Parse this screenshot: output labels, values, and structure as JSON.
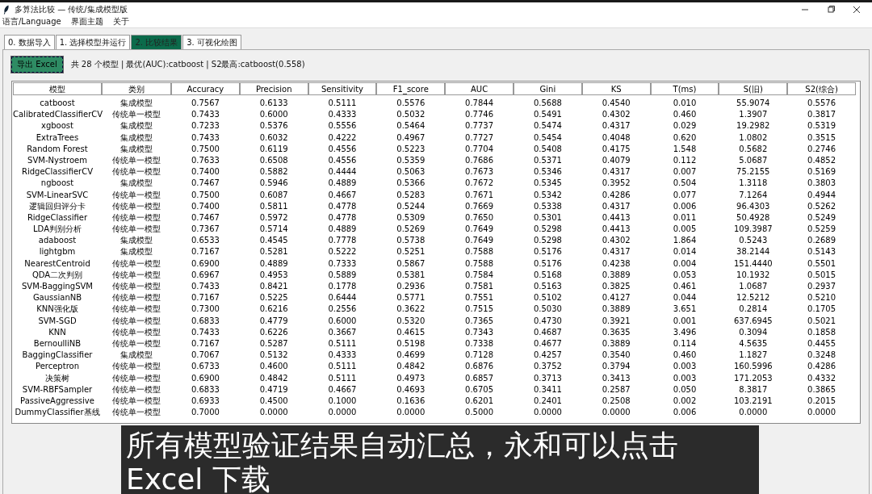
{
  "window": {
    "title": "多算法比较 — 传统/集成模型版"
  },
  "menu": [
    "语言/Language",
    "界面主题",
    "关于"
  ],
  "tabs": [
    {
      "label": "0. 数据导入",
      "selected": false
    },
    {
      "label": "1. 选择模型并运行",
      "selected": false
    },
    {
      "label": "2. 比较结果",
      "selected": true
    },
    {
      "label": "3. 可视化绘图",
      "selected": false
    }
  ],
  "export_button": "导出 Excel",
  "summary": "共 28 个模型 | 最优(AUC):catboost | S2最高:catboost(0.558)",
  "table": {
    "columns": [
      "模型",
      "类别",
      "Accuracy",
      "Precision",
      "Sensitivity",
      "F1_score",
      "AUC",
      "Gini",
      "KS",
      "T(ms)",
      "S(旧)",
      "S2(综合)"
    ],
    "rows": [
      [
        "catboost",
        "集成模型",
        "0.7567",
        "0.6133",
        "0.5111",
        "0.5576",
        "0.7844",
        "0.5688",
        "0.4540",
        "0.010",
        "55.9074",
        "0.5576"
      ],
      [
        "CalibratedClassifierCV",
        "传统单一模型",
        "0.7433",
        "0.6000",
        "0.4333",
        "0.5032",
        "0.7746",
        "0.5491",
        "0.4302",
        "0.460",
        "1.3907",
        "0.3817"
      ],
      [
        "xgboost",
        "集成模型",
        "0.7233",
        "0.5376",
        "0.5556",
        "0.5464",
        "0.7737",
        "0.5474",
        "0.4317",
        "0.029",
        "19.2982",
        "0.5319"
      ],
      [
        "ExtraTrees",
        "集成模型",
        "0.7433",
        "0.6032",
        "0.4222",
        "0.4967",
        "0.7727",
        "0.5454",
        "0.4048",
        "0.620",
        "1.0802",
        "0.3515"
      ],
      [
        "Random Forest",
        "集成模型",
        "0.7500",
        "0.6119",
        "0.4556",
        "0.5223",
        "0.7704",
        "0.5408",
        "0.4175",
        "1.548",
        "0.5682",
        "0.2746"
      ],
      [
        "SVM-Nystroem",
        "传统单一模型",
        "0.7633",
        "0.6508",
        "0.4556",
        "0.5359",
        "0.7686",
        "0.5371",
        "0.4079",
        "0.112",
        "5.0687",
        "0.4852"
      ],
      [
        "RidgeClassifierCV",
        "传统单一模型",
        "0.7400",
        "0.5882",
        "0.4444",
        "0.5063",
        "0.7673",
        "0.5346",
        "0.4317",
        "0.007",
        "75.2155",
        "0.5169"
      ],
      [
        "ngboost",
        "集成模型",
        "0.7467",
        "0.5946",
        "0.4889",
        "0.5366",
        "0.7672",
        "0.5345",
        "0.3952",
        "0.504",
        "1.3118",
        "0.3803"
      ],
      [
        "SVM-LinearSVC",
        "传统单一模型",
        "0.7500",
        "0.6087",
        "0.4667",
        "0.5283",
        "0.7671",
        "0.5342",
        "0.4286",
        "0.077",
        "7.1264",
        "0.4944"
      ],
      [
        "逻辑回归评分卡",
        "传统单一模型",
        "0.7400",
        "0.5811",
        "0.4778",
        "0.5244",
        "0.7669",
        "0.5338",
        "0.4317",
        "0.006",
        "96.4303",
        "0.5262"
      ],
      [
        "RidgeClassifier",
        "传统单一模型",
        "0.7467",
        "0.5972",
        "0.4778",
        "0.5309",
        "0.7650",
        "0.5301",
        "0.4413",
        "0.011",
        "50.4928",
        "0.5249"
      ],
      [
        "LDA判别分析",
        "传统单一模型",
        "0.7367",
        "0.5714",
        "0.4889",
        "0.5269",
        "0.7649",
        "0.5298",
        "0.4413",
        "0.005",
        "109.3987",
        "0.5259"
      ],
      [
        "adaboost",
        "集成模型",
        "0.6533",
        "0.4545",
        "0.7778",
        "0.5738",
        "0.7649",
        "0.5298",
        "0.4302",
        "1.864",
        "0.5243",
        "0.2689"
      ],
      [
        "lightgbm",
        "集成模型",
        "0.7167",
        "0.5281",
        "0.5222",
        "0.5251",
        "0.7588",
        "0.5176",
        "0.4317",
        "0.014",
        "38.2144",
        "0.5143"
      ],
      [
        "NearestCentroid",
        "传统单一模型",
        "0.6900",
        "0.4889",
        "0.7333",
        "0.5867",
        "0.7588",
        "0.5176",
        "0.4238",
        "0.004",
        "151.4440",
        "0.5501"
      ],
      [
        "QDA二次判别",
        "传统单一模型",
        "0.6967",
        "0.4953",
        "0.5889",
        "0.5381",
        "0.7584",
        "0.5168",
        "0.3889",
        "0.053",
        "10.1932",
        "0.5015"
      ],
      [
        "SVM-BaggingSVM",
        "传统单一模型",
        "0.7433",
        "0.8421",
        "0.1778",
        "0.2936",
        "0.7581",
        "0.5163",
        "0.3825",
        "0.461",
        "1.0687",
        "0.2937"
      ],
      [
        "GaussianNB",
        "传统单一模型",
        "0.7167",
        "0.5225",
        "0.6444",
        "0.5771",
        "0.7551",
        "0.5102",
        "0.4127",
        "0.044",
        "12.5212",
        "0.5210"
      ],
      [
        "KNN强化版",
        "传统单一模型",
        "0.7300",
        "0.6216",
        "0.2556",
        "0.3622",
        "0.7515",
        "0.5030",
        "0.3889",
        "3.651",
        "0.2814",
        "0.1705"
      ],
      [
        "SVM-SGD",
        "传统单一模型",
        "0.6833",
        "0.4779",
        "0.6000",
        "0.5320",
        "0.7365",
        "0.4730",
        "0.3921",
        "0.001",
        "637.6945",
        "0.5021"
      ],
      [
        "KNN",
        "传统单一模型",
        "0.7433",
        "0.6226",
        "0.3667",
        "0.4615",
        "0.7343",
        "0.4687",
        "0.3635",
        "3.496",
        "0.3094",
        "0.1858"
      ],
      [
        "BernoulliNB",
        "传统单一模型",
        "0.7167",
        "0.5287",
        "0.5111",
        "0.5198",
        "0.7338",
        "0.4677",
        "0.3889",
        "0.114",
        "4.5635",
        "0.4455"
      ],
      [
        "BaggingClassifier",
        "集成模型",
        "0.7067",
        "0.5132",
        "0.4333",
        "0.4699",
        "0.7128",
        "0.4257",
        "0.3540",
        "0.460",
        "1.1827",
        "0.3248"
      ],
      [
        "Perceptron",
        "传统单一模型",
        "0.6733",
        "0.4600",
        "0.5111",
        "0.4842",
        "0.6876",
        "0.3752",
        "0.3794",
        "0.003",
        "160.5996",
        "0.4286"
      ],
      [
        "决策树",
        "传统单一模型",
        "0.6900",
        "0.4842",
        "0.5111",
        "0.4973",
        "0.6857",
        "0.3713",
        "0.3413",
        "0.003",
        "171.2053",
        "0.4332"
      ],
      [
        "SVM-RBFSampler",
        "传统单一模型",
        "0.6833",
        "0.4719",
        "0.4667",
        "0.4693",
        "0.6705",
        "0.3411",
        "0.2587",
        "0.050",
        "8.3817",
        "0.3865"
      ],
      [
        "PassiveAggressive",
        "传统单一模型",
        "0.6933",
        "0.4500",
        "0.1000",
        "0.1636",
        "0.6201",
        "0.2401",
        "0.2508",
        "0.002",
        "103.2191",
        "0.2015"
      ],
      [
        "DummyClassifier基线",
        "传统单一模型",
        "0.7000",
        "0.0000",
        "0.0000",
        "0.0000",
        "0.5000",
        "0.0000",
        "0.0000",
        "0.006",
        "0.0000",
        "0.0000"
      ]
    ]
  },
  "caption": "所有模型验证结果自动汇总，永和可以点击Excel 下载"
}
